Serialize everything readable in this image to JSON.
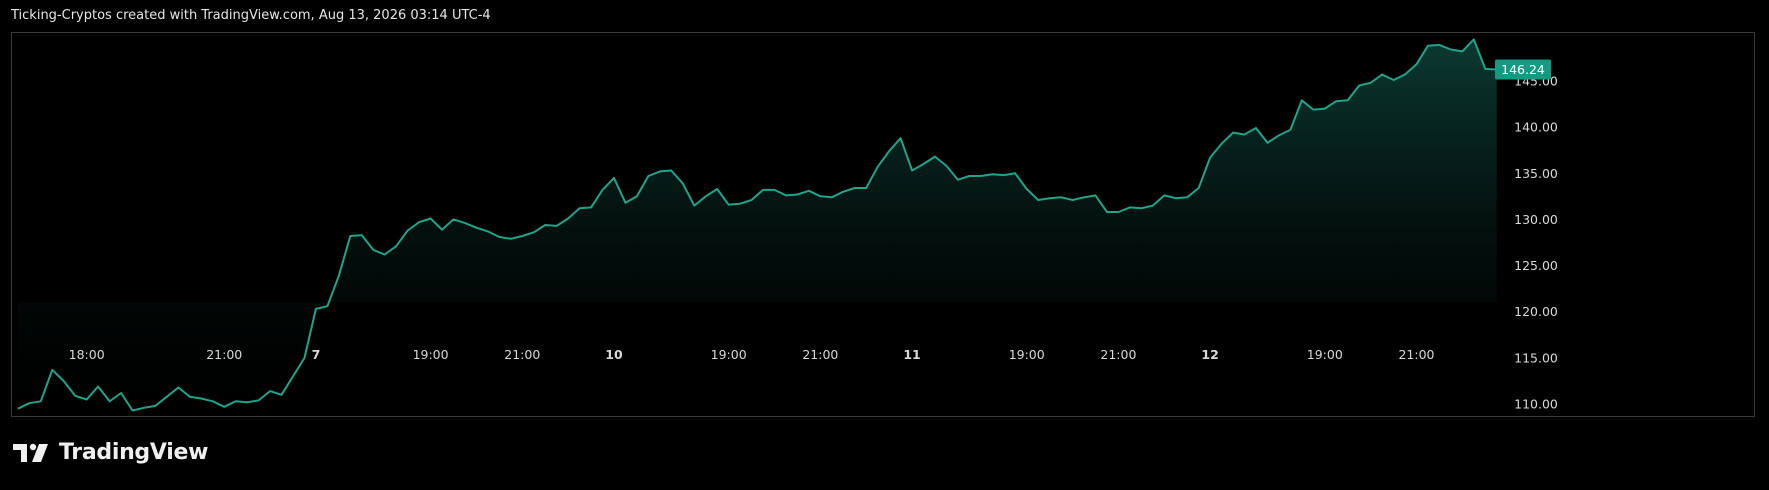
{
  "header": {
    "caption": "Ticking-Cryptos created with TradingView.com, Aug 13, 2026 03:14 UTC-4"
  },
  "brand": {
    "name": "TradingView",
    "logo_icon": "tradingview-logo-icon"
  },
  "colors": {
    "line": "#22a38a",
    "area_top": "#0b3a32",
    "badge": "#149a80",
    "background": "#000000"
  },
  "last_price": {
    "label": "146.24"
  },
  "chart_data": {
    "type": "area",
    "ylim": [
      108.6,
      150.3
    ],
    "y_ticks": [
      {
        "value": 145,
        "label": "145.00"
      },
      {
        "value": 140,
        "label": "140.00"
      },
      {
        "value": 135,
        "label": "135.00"
      },
      {
        "value": 130,
        "label": "130.00"
      },
      {
        "value": 125,
        "label": "125.00"
      },
      {
        "value": 120,
        "label": "120.00"
      },
      {
        "value": 115,
        "label": "115.00"
      },
      {
        "value": 110,
        "label": "110.00"
      }
    ],
    "x_ticks": [
      {
        "index": 6,
        "label": "18:00",
        "bold": false
      },
      {
        "index": 18,
        "label": "21:00",
        "bold": false
      },
      {
        "index": 26,
        "label": "7",
        "bold": true
      },
      {
        "index": 36,
        "label": "19:00",
        "bold": false
      },
      {
        "index": 44,
        "label": "21:00",
        "bold": false
      },
      {
        "index": 52,
        "label": "10",
        "bold": true
      },
      {
        "index": 62,
        "label": "19:00",
        "bold": false
      },
      {
        "index": 70,
        "label": "21:00",
        "bold": false
      },
      {
        "index": 78,
        "label": "11",
        "bold": true
      },
      {
        "index": 88,
        "label": "19:00",
        "bold": false
      },
      {
        "index": 96,
        "label": "21:00",
        "bold": false
      },
      {
        "index": 104,
        "label": "12",
        "bold": true
      },
      {
        "index": 114,
        "label": "19:00",
        "bold": false
      },
      {
        "index": 122,
        "label": "21:00",
        "bold": false
      }
    ],
    "x_index_range": [
      -0.6,
      128.5
    ],
    "values": [
      109.5,
      110.1,
      110.3,
      113.7,
      112.5,
      110.9,
      110.5,
      111.9,
      110.3,
      111.2,
      109.3,
      109.6,
      109.8,
      110.8,
      111.8,
      110.8,
      110.6,
      110.3,
      109.7,
      110.3,
      110.2,
      110.4,
      111.4,
      111.0,
      113.0,
      115.0,
      120.3,
      120.6,
      123.9,
      128.2,
      128.3,
      126.7,
      126.2,
      127.1,
      128.8,
      129.7,
      130.1,
      128.9,
      130.0,
      129.6,
      129.1,
      128.7,
      128.1,
      127.9,
      128.2,
      128.6,
      129.4,
      129.3,
      130.1,
      131.2,
      131.3,
      133.2,
      134.5,
      131.8,
      132.5,
      134.7,
      135.2,
      135.3,
      133.9,
      131.5,
      132.5,
      133.3,
      131.6,
      131.7,
      132.1,
      133.2,
      133.2,
      132.6,
      132.7,
      133.1,
      132.5,
      132.4,
      133.0,
      133.4,
      133.4,
      135.7,
      137.4,
      138.8,
      135.3,
      136.0,
      136.8,
      135.8,
      134.3,
      134.7,
      134.7,
      134.9,
      134.8,
      135.0,
      133.3,
      132.1,
      132.3,
      132.4,
      132.1,
      132.4,
      132.6,
      130.8,
      130.8,
      131.3,
      131.2,
      131.5,
      132.6,
      132.3,
      132.4,
      133.4,
      136.7,
      138.2,
      139.4,
      139.2,
      139.9,
      138.3,
      139.1,
      139.7,
      142.9,
      141.9,
      142.0,
      142.8,
      142.9,
      144.5,
      144.8,
      145.7,
      145.1,
      145.7,
      146.8,
      148.8,
      148.9,
      148.4,
      148.2,
      149.5,
      146.3,
      146.24
    ]
  }
}
